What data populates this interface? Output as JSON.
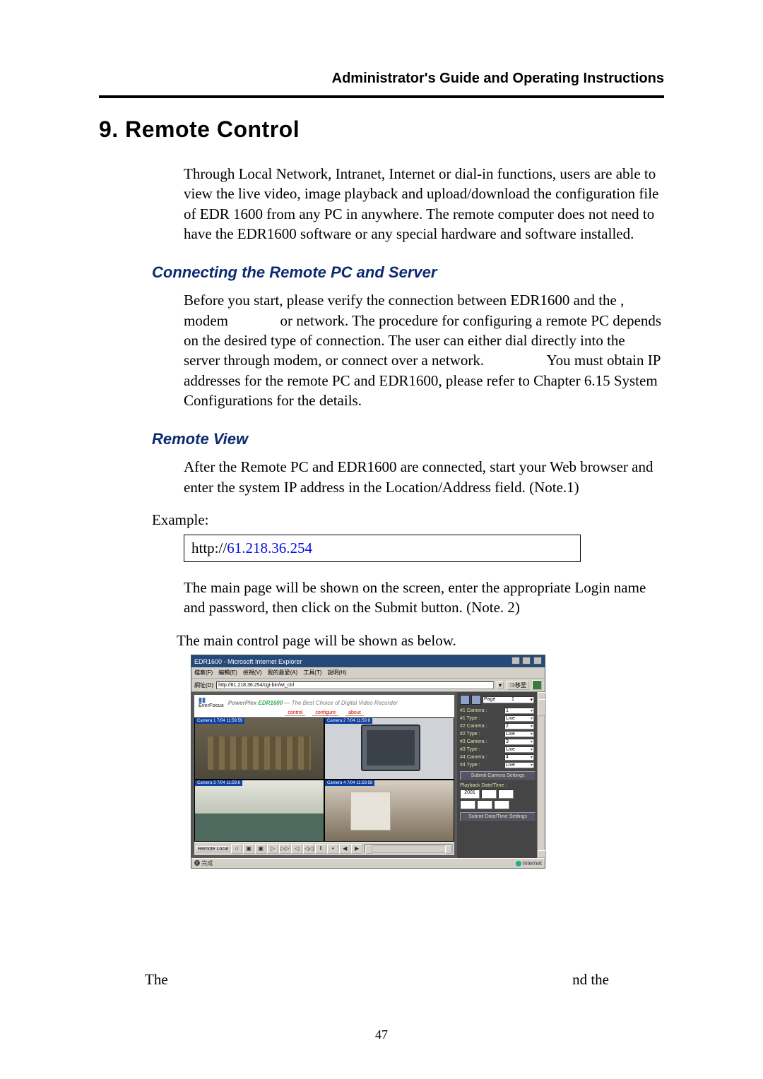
{
  "header": {
    "running_title": "Administrator's Guide and Operating Instructions"
  },
  "section": {
    "title": "9. Remote Control",
    "intro": "Through Local Network, Intranet, Internet or dial-in functions, users are able to view the live video, image playback and upload/download the configuration file of EDR 1600 from any PC in anywhere. The remote computer does not need to have the EDR1600 software or any special hardware and software installed."
  },
  "sub1": {
    "heading": "Connecting the Remote PC and Server",
    "para": "Before you start, please verify the connection between EDR1600 and the , modem              or network. The procedure for configuring a remote PC depends on the desired type of connection. The user can either dial directly into the server through modem, or connect over a network.                 You must obtain IP addresses for the remote PC and EDR1600, please refer to Chapter 6.15 System Configurations for the details."
  },
  "sub2": {
    "heading": "Remote View",
    "para1": "After the Remote PC and EDR1600 are connected, start your Web browser and enter the system IP address in the Location/Address field. (Note.1)",
    "example_label": "Example:",
    "url_prefix": "http://",
    "url_link": "61.218.36.254",
    "para2": "The main page will be shown on the screen, enter the appropriate Login name and password, then click on the Submit button. (Note. 2)",
    "para3": "The main control page will be shown as below."
  },
  "cut": {
    "left": "The",
    "right": "nd the"
  },
  "page_number": "47",
  "screenshot": {
    "window_title": "EDR1600 - Microsoft Internet Explorer",
    "menus": [
      "檔案(F)",
      "編輯(E)",
      "檢視(V)",
      "我的最愛(A)",
      "工具(T)",
      "說明(H)"
    ],
    "address_label": "網址(D)",
    "address_value": "http://61.218.36.254/cgi-bin/wt_ctrl",
    "go_label": "移至",
    "brand_logo_top": "▮▮",
    "brand_logo_bottom": "EverFocus",
    "brand_line_1": "PowerPlex",
    "brand_line_2": "EDR1600",
    "brand_line_3": "— The Best Choice of Digital Video Recorder",
    "tabs": [
      "control",
      "configure",
      "about"
    ],
    "cameras": [
      {
        "label": "Camera 1  7/04 11:59:59"
      },
      {
        "label": "Camera 2  7/04 11:59:8"
      },
      {
        "label": "Camera 3  7/04 11:59:8"
      },
      {
        "label": "Camera 4  7/04 11:59:58"
      }
    ],
    "side": {
      "page_label": "Page",
      "page_value": "1",
      "rows": [
        {
          "label": "#1 Camera :",
          "value": "1"
        },
        {
          "label": "#1 Type :",
          "value": "Live"
        },
        {
          "label": "#2 Camera :",
          "value": "2"
        },
        {
          "label": "#2 Type :",
          "value": "Live"
        },
        {
          "label": "#3 Camera :",
          "value": "3"
        },
        {
          "label": "#3 Type :",
          "value": "Live"
        },
        {
          "label": "#4 Camera :",
          "value": "4"
        },
        {
          "label": "#4 Type :",
          "value": "Live"
        }
      ],
      "submit_cam": "Submit Camera Settings",
      "playback_head": "Playback Date/Time :",
      "dt_year": "2001",
      "submit_dt": "Submit Date/Time Settings"
    },
    "toolbar": {
      "label": "Remote Local",
      "icons": [
        "⌂",
        "▣",
        "▣",
        "▷",
        "▷▷",
        "◁",
        "◁◁",
        "‖",
        "•",
        "◀",
        "▶"
      ]
    },
    "status_left": "完成",
    "status_right": "Internet"
  }
}
